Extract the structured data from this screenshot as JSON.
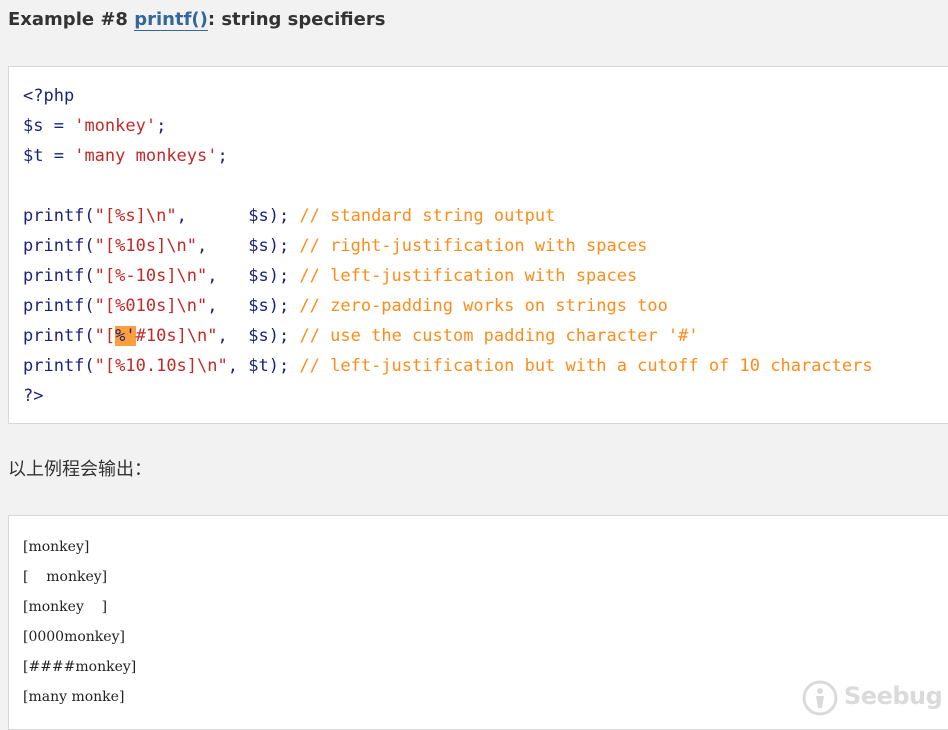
{
  "header": {
    "prefix": "Example #8 ",
    "function_link": "printf()",
    "suffix": ": string specifiers"
  },
  "code": {
    "lines": [
      {
        "tokens": [
          {
            "t": "<?php",
            "c": "kw"
          }
        ]
      },
      {
        "tokens": [
          {
            "t": "$s",
            "c": "var"
          },
          {
            "t": " = ",
            "c": "punct"
          },
          {
            "t": "'monkey'",
            "c": "str"
          },
          {
            "t": ";",
            "c": "punct"
          }
        ]
      },
      {
        "tokens": [
          {
            "t": "$t",
            "c": "var"
          },
          {
            "t": " = ",
            "c": "punct"
          },
          {
            "t": "'many monkeys'",
            "c": "str"
          },
          {
            "t": ";",
            "c": "punct"
          }
        ]
      },
      {
        "tokens": []
      },
      {
        "tokens": [
          {
            "t": "printf",
            "c": "kw"
          },
          {
            "t": "(",
            "c": "punct"
          },
          {
            "t": "\"[%s]\\n\"",
            "c": "str"
          },
          {
            "t": ",      ",
            "c": "punct"
          },
          {
            "t": "$s",
            "c": "var"
          },
          {
            "t": "); ",
            "c": "punct"
          },
          {
            "t": "// standard string output",
            "c": "cmt"
          }
        ]
      },
      {
        "tokens": [
          {
            "t": "printf",
            "c": "kw"
          },
          {
            "t": "(",
            "c": "punct"
          },
          {
            "t": "\"[%10s]\\n\"",
            "c": "str"
          },
          {
            "t": ",    ",
            "c": "punct"
          },
          {
            "t": "$s",
            "c": "var"
          },
          {
            "t": "); ",
            "c": "punct"
          },
          {
            "t": "// right-justification with spaces",
            "c": "cmt"
          }
        ]
      },
      {
        "tokens": [
          {
            "t": "printf",
            "c": "kw"
          },
          {
            "t": "(",
            "c": "punct"
          },
          {
            "t": "\"[%-10s]\\n\"",
            "c": "str"
          },
          {
            "t": ",   ",
            "c": "punct"
          },
          {
            "t": "$s",
            "c": "var"
          },
          {
            "t": "); ",
            "c": "punct"
          },
          {
            "t": "// left-justification with spaces",
            "c": "cmt"
          }
        ]
      },
      {
        "tokens": [
          {
            "t": "printf",
            "c": "kw"
          },
          {
            "t": "(",
            "c": "punct"
          },
          {
            "t": "\"[%010s]\\n\"",
            "c": "str"
          },
          {
            "t": ",   ",
            "c": "punct"
          },
          {
            "t": "$s",
            "c": "var"
          },
          {
            "t": "); ",
            "c": "punct"
          },
          {
            "t": "// zero-padding works on strings too",
            "c": "cmt"
          }
        ]
      },
      {
        "tokens": [
          {
            "t": "printf",
            "c": "kw"
          },
          {
            "t": "(",
            "c": "punct"
          },
          {
            "t": "\"[",
            "c": "str"
          },
          {
            "t": "%'",
            "c": "hl"
          },
          {
            "t": "#10s]\\n\"",
            "c": "str"
          },
          {
            "t": ",  ",
            "c": "punct"
          },
          {
            "t": "$s",
            "c": "var"
          },
          {
            "t": "); ",
            "c": "punct"
          },
          {
            "t": "// use the custom padding character '#'",
            "c": "cmt"
          }
        ]
      },
      {
        "tokens": [
          {
            "t": "printf",
            "c": "kw"
          },
          {
            "t": "(",
            "c": "punct"
          },
          {
            "t": "\"[%10.10s]\\n\"",
            "c": "str"
          },
          {
            "t": ", ",
            "c": "punct"
          },
          {
            "t": "$t",
            "c": "var"
          },
          {
            "t": "); ",
            "c": "punct"
          },
          {
            "t": "// left-justification but with a cutoff of 10 characters",
            "c": "cmt"
          }
        ]
      },
      {
        "tokens": [
          {
            "t": "?>",
            "c": "kw"
          }
        ]
      }
    ]
  },
  "caption": "以上例程会输出：",
  "output": {
    "lines": [
      "[monkey]",
      "[    monkey]",
      "[monkey    ]",
      "[0000monkey]",
      "[####monkey]",
      "[many monke]"
    ]
  },
  "watermark": {
    "text": "Seebug"
  },
  "colors": {
    "keyword": "#1a237e",
    "string": "#c62828",
    "comment": "#ff8c1a",
    "highlight": "#ff9e3d",
    "link": "#336699",
    "background": "#f2f2f2"
  }
}
